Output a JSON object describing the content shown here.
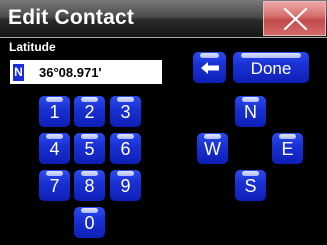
{
  "window": {
    "title": "Edit Contact",
    "close_icon": "close-x-icon"
  },
  "field": {
    "label": "Latitude",
    "hemisphere": "N",
    "value": "36°08.971'"
  },
  "keypad": {
    "k1": "1",
    "k2": "2",
    "k3": "3",
    "k4": "4",
    "k5": "5",
    "k6": "6",
    "k7": "7",
    "k8": "8",
    "k9": "9",
    "k0": "0"
  },
  "actions": {
    "backspace_icon": "left-arrow-icon",
    "done": "Done"
  },
  "hemisphere_keys": {
    "north": "N",
    "west": "W",
    "east": "E",
    "south": "S"
  },
  "colors": {
    "key_blue": "#1a31d4",
    "close_red": "#d46b6b",
    "hemisphere_badge": "#1a2cd6"
  }
}
